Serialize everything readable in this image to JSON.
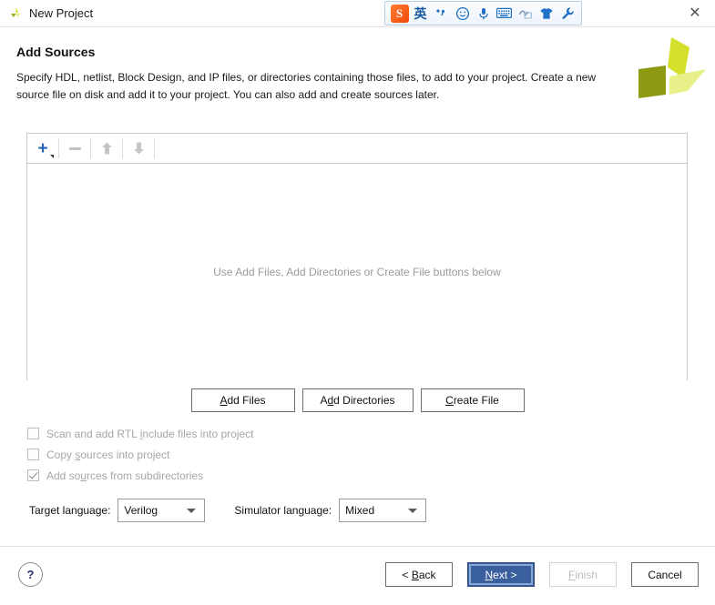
{
  "window": {
    "title": "New Project",
    "app_icon": "xilinx-vivado-icon",
    "close_label": "✕"
  },
  "ime_toolbar": {
    "logo_text": "S",
    "items": [
      {
        "name": "sogou-logo-icon",
        "glyph": "S"
      },
      {
        "name": "language-mode-icon",
        "glyph": "英"
      },
      {
        "name": "punctuation-mode-icon",
        "glyph": "•‚"
      },
      {
        "name": "emoji-icon",
        "glyph": "☺"
      },
      {
        "name": "voice-input-icon",
        "glyph": "ⵍ"
      },
      {
        "name": "soft-keyboard-icon",
        "glyph": "⌨"
      },
      {
        "name": "handwriting-icon",
        "glyph": "✎"
      },
      {
        "name": "skin-icon",
        "glyph": "Ũ"
      },
      {
        "name": "settings-wrench-icon",
        "glyph": "⚒"
      }
    ]
  },
  "header": {
    "title": "Add Sources",
    "description": "Specify HDL, netlist, Block Design, and IP files, or directories containing those files, to add to your project. Create a new source file on disk and add it to your project. You can also add and create sources later.",
    "brand_logo": "xilinx-logo"
  },
  "sources_panel": {
    "toolbar": [
      {
        "name": "add-source-button",
        "glyph": "+",
        "enabled": true
      },
      {
        "name": "remove-source-button",
        "glyph": "−",
        "enabled": false
      },
      {
        "name": "move-up-button",
        "glyph": "⬆",
        "enabled": false
      },
      {
        "name": "move-down-button",
        "glyph": "⬇",
        "enabled": false
      }
    ],
    "empty_message": "Use Add Files, Add Directories or Create File buttons below"
  },
  "actions": {
    "add_files": {
      "prefix": "",
      "accel": "A",
      "rest": "dd Files"
    },
    "add_directories": {
      "prefix": "A",
      "accel": "d",
      "rest": "d Directories"
    },
    "create_file": {
      "prefix": "",
      "accel": "C",
      "rest": "reate File"
    }
  },
  "options": [
    {
      "name": "scan-rtl-include-checkbox",
      "checked": false,
      "enabled": false,
      "before": "Scan and add RTL ",
      "accel": "i",
      "after": "nclude files into project"
    },
    {
      "name": "copy-sources-checkbox",
      "checked": false,
      "enabled": false,
      "before": "Copy ",
      "accel": "s",
      "after": "ources into project"
    },
    {
      "name": "add-sources-subdirectories-checkbox",
      "checked": true,
      "enabled": true,
      "before": "Add so",
      "accel": "u",
      "after": "rces from subdirectories"
    }
  ],
  "languages": {
    "target_label": "Target language:",
    "target_value": "Verilog",
    "simulator_label": "Simulator language:",
    "simulator_value": "Mixed"
  },
  "footer": {
    "help_glyph": "?",
    "back": {
      "before": "< ",
      "accel": "B",
      "after": "ack"
    },
    "next": {
      "before": "",
      "accel": "N",
      "after": "ext >"
    },
    "finish": {
      "before": "",
      "accel": "F",
      "after": "inish"
    },
    "cancel_label": "Cancel"
  },
  "colors": {
    "primary_button": "#3a5f9e",
    "accent_blue": "#2a62b5",
    "brand_yellow": "#c8d400",
    "ime_blue": "#1f6fc4",
    "ime_orange": "#f2490b"
  }
}
